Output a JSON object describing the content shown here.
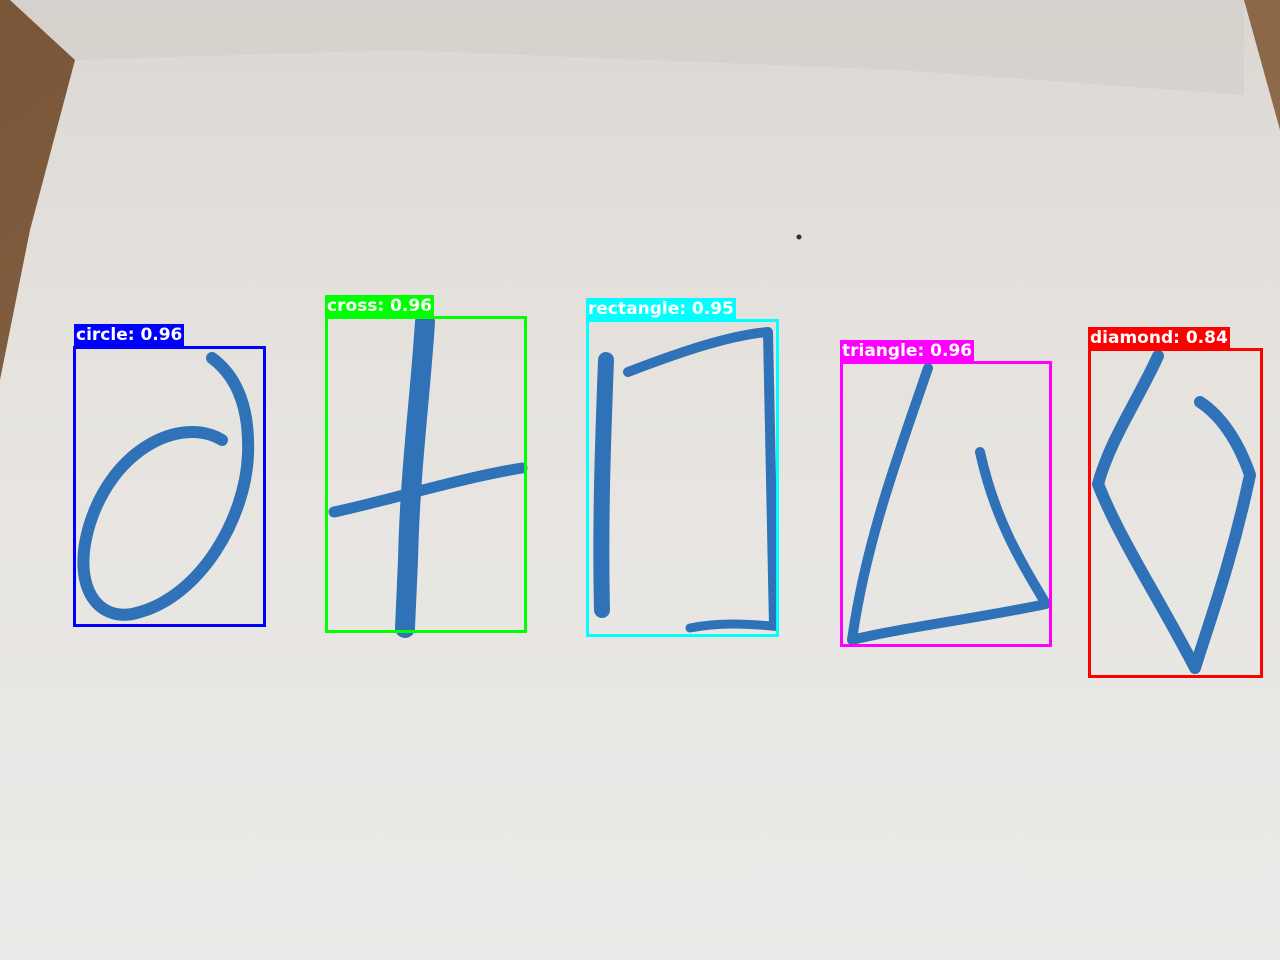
{
  "stroke_color": "#2f72b8",
  "paper_color": "#e7e4e1",
  "detections": [
    {
      "label": "circle: 0.96",
      "color": "#0000ff"
    },
    {
      "label": "cross: 0.96",
      "color": "#00ff00"
    },
    {
      "label": "rectangle: 0.95",
      "color": "#00ffff"
    },
    {
      "label": "triangle: 0.96",
      "color": "#ff00ff"
    },
    {
      "label": "diamond: 0.84",
      "color": "#ff0000"
    }
  ]
}
